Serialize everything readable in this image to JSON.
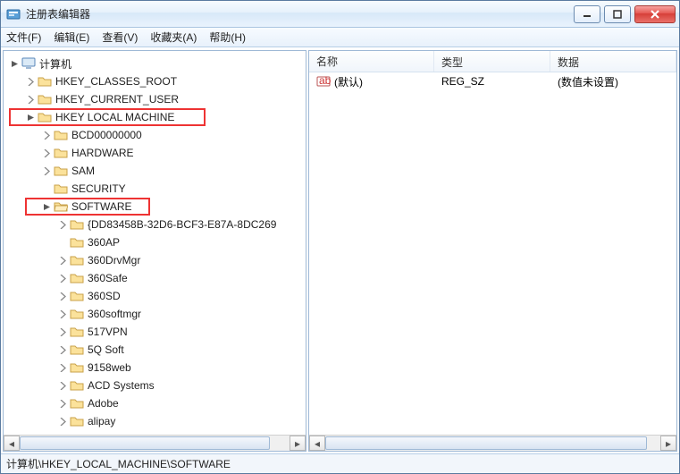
{
  "window": {
    "title": "注册表编辑器"
  },
  "menu": {
    "file": "文件(F)",
    "edit": "编辑(E)",
    "view": "查看(V)",
    "favorites": "收藏夹(A)",
    "help": "帮助(H)"
  },
  "tree": {
    "root": "计算机",
    "hkcr": "HKEY_CLASSES_ROOT",
    "hkcu": "HKEY_CURRENT_USER",
    "hklm": "HKEY LOCAL MACHINE",
    "hklm_children": {
      "bcd": "BCD00000000",
      "hardware": "HARDWARE",
      "sam": "SAM",
      "security": "SECURITY",
      "software": "SOFTWARE",
      "software_children": {
        "guid": "{DD83458B-32D6-BCF3-E87A-8DC269",
        "ap": "360AP",
        "drvmgr": "360DrvMgr",
        "safe": "360Safe",
        "sd": "360SD",
        "softmgr": "360softmgr",
        "vpn": "517VPN",
        "fiveq": "5Q Soft",
        "web": "9158web",
        "acd": "ACD Systems",
        "adobe": "Adobe",
        "alipay": "alipay"
      }
    }
  },
  "list": {
    "header": {
      "name": "名称",
      "type": "类型",
      "data": "数据"
    },
    "rows": [
      {
        "name": "(默认)",
        "type": "REG_SZ",
        "data": "(数值未设置)"
      }
    ]
  },
  "status": {
    "path": "计算机\\HKEY_LOCAL_MACHINE\\SOFTWARE"
  }
}
